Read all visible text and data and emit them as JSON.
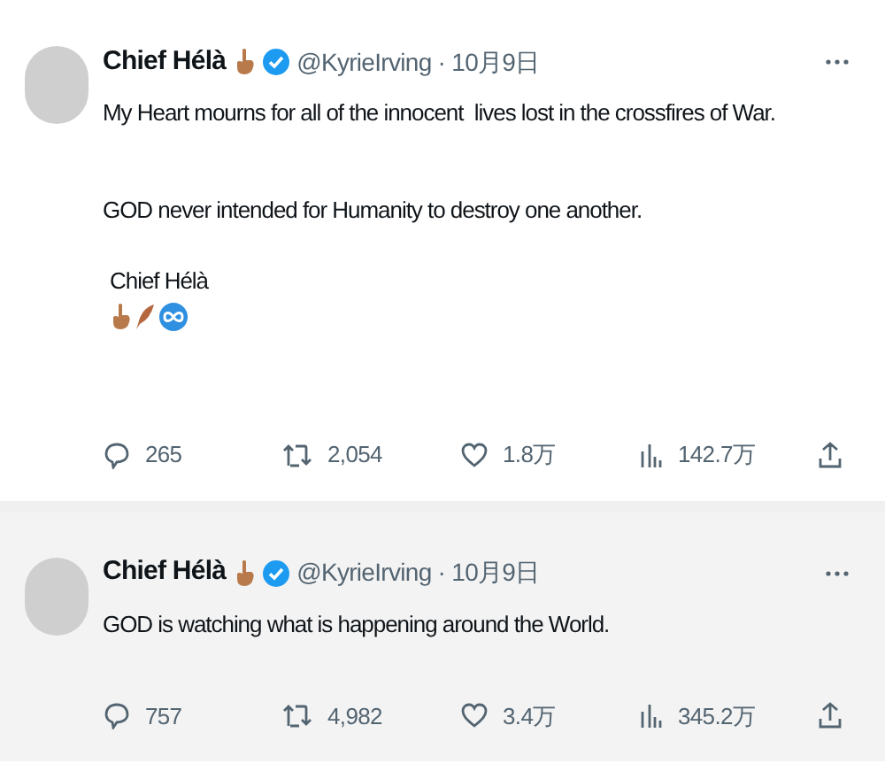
{
  "tweets": [
    {
      "name": "Chief Hélà",
      "handle": "@KyrieIrving · 10月9日",
      "hovered": false,
      "paragraphs": [
        "My Heart mourns for all of the innocent  lives lost in the crossfires of War.",
        "GOD never intended for Humanity to destroy one another.",
        "Chief Hélà"
      ],
      "signature_icons": [
        {
          "kind": "hand"
        },
        {
          "kind": "feather"
        },
        {
          "kind": "infinity"
        }
      ],
      "stats": {
        "replies": "265",
        "reposts": "2,054",
        "likes": "1.8万",
        "views": "142.7万"
      }
    },
    {
      "name": "Chief Hélà",
      "handle": "@KyrieIrving · 10月9日",
      "hovered": true,
      "paragraphs": [
        "GOD is watching what is happening around the World."
      ],
      "stats": {
        "replies": "757",
        "reposts": "4,982",
        "likes": "3.4万",
        "views": "345.2万"
      }
    }
  ]
}
